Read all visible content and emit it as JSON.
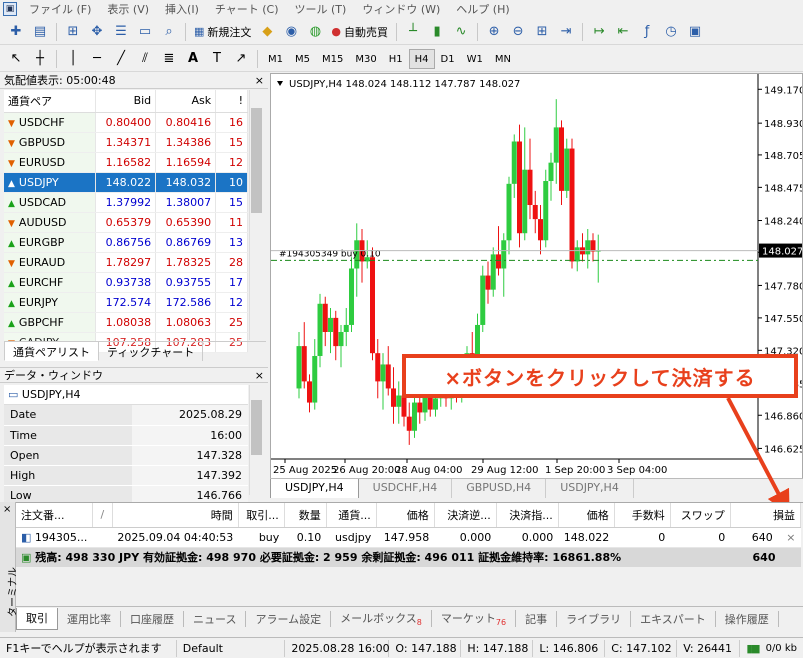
{
  "menu": {
    "app_icon": "mt4-icon",
    "items": [
      "ファイル (F)",
      "表示 (V)",
      "挿入(I)",
      "チャート (C)",
      "ツール (T)",
      "ウィンドウ (W)",
      "ヘルプ (H)"
    ]
  },
  "toolbar": {
    "new_order": "新規注文",
    "auto_trade": "自動売買",
    "timeframes": [
      "M1",
      "M5",
      "M15",
      "M30",
      "H1",
      "H4",
      "D1",
      "W1",
      "MN"
    ],
    "active_timeframe": "H4"
  },
  "market_watch": {
    "title": "気配値表示: 05:00:48",
    "close": "×",
    "headers": [
      "通貨ペア",
      "Bid",
      "Ask",
      "!"
    ],
    "rows": [
      {
        "symbol": "USDCHF",
        "bid": "0.80400",
        "ask": "0.80416",
        "spread": "16",
        "dir": "down",
        "color": "red"
      },
      {
        "symbol": "GBPUSD",
        "bid": "1.34371",
        "ask": "1.34386",
        "spread": "15",
        "dir": "down",
        "color": "red"
      },
      {
        "symbol": "EURUSD",
        "bid": "1.16582",
        "ask": "1.16594",
        "spread": "12",
        "dir": "down",
        "color": "red"
      },
      {
        "symbol": "USDJPY",
        "bid": "148.022",
        "ask": "148.032",
        "spread": "10",
        "dir": "up",
        "color": "sel"
      },
      {
        "symbol": "USDCAD",
        "bid": "1.37992",
        "ask": "1.38007",
        "spread": "15",
        "dir": "up",
        "color": "blue"
      },
      {
        "symbol": "AUDUSD",
        "bid": "0.65379",
        "ask": "0.65390",
        "spread": "11",
        "dir": "down",
        "color": "red"
      },
      {
        "symbol": "EURGBP",
        "bid": "0.86756",
        "ask": "0.86769",
        "spread": "13",
        "dir": "up",
        "color": "blue"
      },
      {
        "symbol": "EURAUD",
        "bid": "1.78297",
        "ask": "1.78325",
        "spread": "28",
        "dir": "down",
        "color": "red"
      },
      {
        "symbol": "EURCHF",
        "bid": "0.93738",
        "ask": "0.93755",
        "spread": "17",
        "dir": "up",
        "color": "blue"
      },
      {
        "symbol": "EURJPY",
        "bid": "172.574",
        "ask": "172.586",
        "spread": "12",
        "dir": "up",
        "color": "blue"
      },
      {
        "symbol": "GBPCHF",
        "bid": "1.08038",
        "ask": "1.08063",
        "spread": "25",
        "dir": "up",
        "color": "red"
      },
      {
        "symbol": "CADJPY",
        "bid": "107.258",
        "ask": "107.283",
        "spread": "25",
        "dir": "down",
        "color": "red"
      }
    ],
    "tabs": [
      "通貨ペアリスト",
      "ティックチャート"
    ],
    "active_tab": 0
  },
  "data_window": {
    "title": "データ・ウィンドウ",
    "close": "×",
    "header": "USDJPY,H4",
    "rows": [
      {
        "k": "Date",
        "v": "2025.08.29"
      },
      {
        "k": "Time",
        "v": "16:00"
      },
      {
        "k": "Open",
        "v": "147.328"
      },
      {
        "k": "High",
        "v": "147.392"
      },
      {
        "k": "Low",
        "v": "146.766"
      }
    ]
  },
  "chart": {
    "header": "USDJPY,H4  148.024 148.112 147.787 148.027",
    "order_line_label": "#194305349 buy 0.10",
    "current_price_label": "148.027",
    "callout": "×ボタンをクリックして決済する",
    "tabs": [
      "USDJPY,H4",
      "USDCHF,H4",
      "GBPUSD,H4",
      "USDJPY,H4"
    ],
    "active_tab": 0
  },
  "chart_data": {
    "type": "candlestick",
    "symbol": "USDJPY",
    "timeframe": "H4",
    "ylim": [
      146.55,
      149.25
    ],
    "yticks": [
      "149.170",
      "148.930",
      "148.705",
      "148.475",
      "148.240",
      "148.015",
      "147.780",
      "147.550",
      "147.320",
      "147.085",
      "146.860",
      "146.625"
    ],
    "xticks": [
      "25 Aug 2025",
      "26 Aug 20:00",
      "28 Aug 04:00",
      "29 Aug 12:00",
      "1 Sep 20:00",
      "3 Sep 04:00"
    ],
    "order_price": 147.958,
    "current_price": 148.027,
    "ohlc": [
      [
        147.05,
        147.45,
        146.98,
        147.35
      ],
      [
        147.35,
        147.52,
        147.05,
        147.1
      ],
      [
        147.1,
        147.15,
        146.88,
        146.95
      ],
      [
        146.95,
        147.4,
        146.9,
        147.28
      ],
      [
        147.28,
        147.72,
        147.2,
        147.65
      ],
      [
        147.65,
        147.7,
        147.35,
        147.45
      ],
      [
        147.45,
        147.62,
        147.3,
        147.55
      ],
      [
        147.55,
        147.6,
        147.25,
        147.35
      ],
      [
        147.35,
        147.5,
        147.2,
        147.45
      ],
      [
        147.45,
        147.62,
        147.35,
        147.5
      ],
      [
        147.5,
        147.98,
        147.45,
        147.9
      ],
      [
        147.9,
        148.22,
        147.7,
        148.1
      ],
      [
        148.1,
        148.18,
        147.8,
        147.95
      ],
      [
        147.95,
        148.1,
        147.9,
        147.98
      ],
      [
        147.98,
        148.05,
        147.25,
        147.3
      ],
      [
        147.3,
        147.4,
        146.98,
        147.1
      ],
      [
        147.1,
        147.3,
        146.9,
        147.22
      ],
      [
        147.22,
        147.35,
        147.0,
        147.05
      ],
      [
        147.05,
        147.2,
        146.8,
        146.92
      ],
      [
        146.92,
        147.1,
        146.8,
        147.0
      ],
      [
        147.0,
        147.15,
        146.78,
        146.85
      ],
      [
        146.85,
        146.95,
        146.65,
        146.75
      ],
      [
        146.75,
        147.0,
        146.7,
        146.95
      ],
      [
        146.95,
        147.05,
        146.8,
        146.88
      ],
      [
        146.88,
        147.08,
        146.82,
        147.02
      ],
      [
        147.02,
        147.1,
        146.85,
        146.9
      ],
      [
        146.9,
        147.05,
        146.85,
        146.98
      ],
      [
        146.98,
        147.15,
        146.92,
        147.05
      ],
      [
        147.05,
        147.1,
        146.92,
        146.98
      ],
      [
        146.98,
        147.12,
        146.9,
        147.08
      ],
      [
        147.08,
        147.2,
        146.95,
        147.02
      ],
      [
        147.02,
        147.15,
        146.95,
        147.1
      ],
      [
        147.1,
        147.35,
        147.02,
        147.3
      ],
      [
        147.3,
        147.45,
        147.15,
        147.22
      ],
      [
        147.22,
        147.58,
        147.18,
        147.5
      ],
      [
        147.5,
        147.92,
        147.45,
        147.85
      ],
      [
        147.85,
        147.95,
        147.65,
        147.75
      ],
      [
        147.75,
        148.05,
        147.7,
        148.0
      ],
      [
        148.0,
        148.2,
        147.85,
        147.9
      ],
      [
        147.9,
        148.15,
        147.7,
        148.1
      ],
      [
        148.1,
        148.55,
        148.0,
        148.5
      ],
      [
        148.5,
        148.85,
        148.4,
        148.8
      ],
      [
        148.8,
        148.92,
        148.05,
        148.15
      ],
      [
        148.15,
        148.9,
        148.1,
        148.6
      ],
      [
        148.6,
        148.82,
        148.25,
        148.35
      ],
      [
        148.35,
        148.45,
        148.15,
        148.25
      ],
      [
        148.25,
        148.35,
        148.0,
        148.1
      ],
      [
        148.1,
        148.6,
        148.05,
        148.52
      ],
      [
        148.52,
        148.72,
        148.38,
        148.65
      ],
      [
        148.65,
        149.1,
        148.5,
        148.9
      ],
      [
        148.9,
        148.95,
        148.35,
        148.45
      ],
      [
        148.45,
        148.82,
        148.4,
        148.75
      ],
      [
        148.75,
        148.82,
        147.9,
        147.95
      ],
      [
        147.95,
        148.1,
        147.88,
        148.05
      ],
      [
        148.05,
        148.15,
        147.95,
        148.0
      ],
      [
        148.0,
        148.18,
        147.9,
        148.1
      ],
      [
        148.1,
        148.15,
        147.95,
        148.02
      ],
      [
        148.02,
        148.14,
        147.8,
        148.03
      ]
    ]
  },
  "terminal": {
    "side_label": "ターミナル",
    "close": "×",
    "headers": [
      "注文番...",
      "/",
      "時間",
      "取引...",
      "数量",
      "通貨...",
      "価格",
      "決済逆...",
      "決済指...",
      "価格",
      "手数料",
      "スワップ",
      "損益"
    ],
    "position": {
      "ticket": "194305...",
      "time": "2025.09.04 04:40:53",
      "type": "buy",
      "volume": "0.10",
      "symbol": "usdjpy",
      "open_price": "147.958",
      "sl": "0.000",
      "tp": "0.000",
      "price": "148.022",
      "commission": "0",
      "swap": "0",
      "profit": "640",
      "close": "×"
    },
    "balance_line": "残高: 498 330 JPY  有効証拠金: 498 970  必要証拠金: 2 959  余剰証拠金: 496 011  証拠金維持率: 16861.88%",
    "balance_profit": "640",
    "tabs": [
      {
        "label": "取引",
        "badge": ""
      },
      {
        "label": "運用比率",
        "badge": ""
      },
      {
        "label": "口座履歴",
        "badge": ""
      },
      {
        "label": "ニュース",
        "badge": ""
      },
      {
        "label": "アラーム設定",
        "badge": ""
      },
      {
        "label": "メールボックス",
        "badge": "8"
      },
      {
        "label": "マーケット",
        "badge": "76"
      },
      {
        "label": "記事",
        "badge": ""
      },
      {
        "label": "ライブラリ",
        "badge": ""
      },
      {
        "label": "エキスパート",
        "badge": ""
      },
      {
        "label": "操作履歴",
        "badge": ""
      }
    ],
    "active_tab": 0
  },
  "status": {
    "help": "F1キーでヘルプが表示されます",
    "profile": "Default",
    "datetime": "2025.08.28 16:00",
    "open": "O: 147.188",
    "high": "H: 147.188",
    "low": "L: 146.806",
    "close": "C: 147.102",
    "volume": "V: 26441",
    "traffic": "0/0 kb"
  }
}
